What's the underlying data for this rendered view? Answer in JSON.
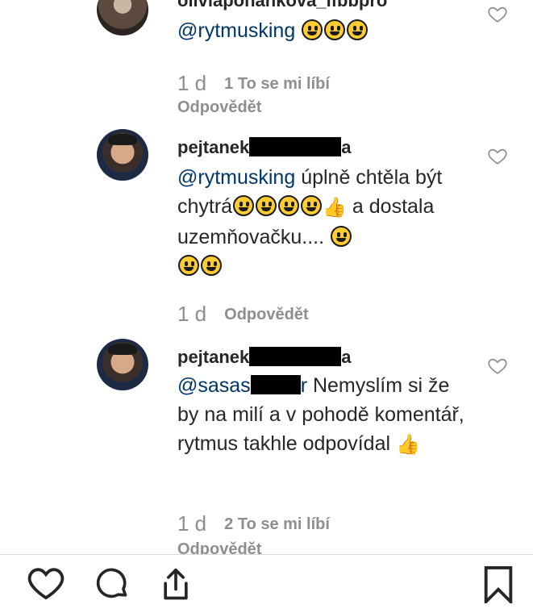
{
  "comments": [
    {
      "username": "oliviaponankova_ifbbpro",
      "mention": "@rytmusking",
      "age": "1 d",
      "likes": "1 To se mi líbí",
      "reply": "Odpovědět"
    },
    {
      "username_prefix": "pejtanek",
      "username_suffix": "a",
      "mention": "@rytmusking",
      "text_part1": " úplně chtěla být chytrá",
      "text_part2": " a dostala uzemňovačku.... ",
      "age": "1 d",
      "reply": "Odpovědět"
    },
    {
      "username_prefix": "pejtanek",
      "username_suffix": "a",
      "mention": "@sasas",
      "text": " Nemyslím si že by na milí a v pohodě komentář, rytmus takhle odpovídal ",
      "age": "1 d",
      "likes": "2 To se mi líbí",
      "reply": "Odpovědět"
    }
  ],
  "icons": {
    "like": "heart-icon",
    "comment": "comment-icon",
    "share": "share-icon",
    "save": "bookmark-icon"
  }
}
